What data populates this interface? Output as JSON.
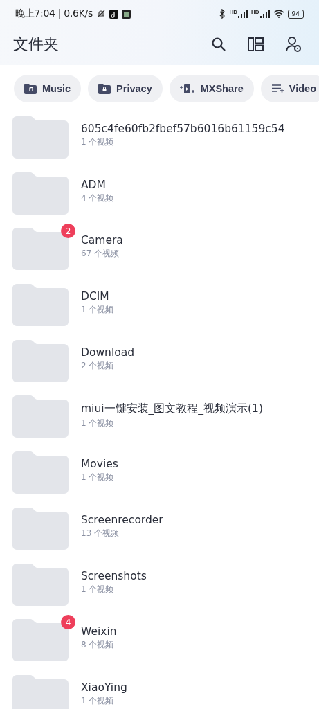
{
  "status_bar": {
    "time": "晚上7:04 | 0.6K/s",
    "signal_labels": [
      "HD",
      "HD"
    ],
    "battery": "94"
  },
  "header": {
    "title": "文件夹"
  },
  "chips": [
    {
      "label": "Music",
      "kind": "music"
    },
    {
      "label": "Privacy",
      "kind": "lock"
    },
    {
      "label": "MXShare",
      "kind": "share"
    },
    {
      "label": "Video",
      "kind": "playlist"
    }
  ],
  "folders": [
    {
      "name": "605c4fe60fb2fbef57b6016b61159c54",
      "count": "1 个视频"
    },
    {
      "name": "ADM",
      "count": "4 个视频"
    },
    {
      "name": "Camera",
      "count": "67 个视频",
      "badge": "2"
    },
    {
      "name": "DCIM",
      "count": "1 个视频"
    },
    {
      "name": "Download",
      "count": "2 个视频"
    },
    {
      "name": "miui一键安装_图文教程_视频演示(1)",
      "count": "1 个视频"
    },
    {
      "name": "Movies",
      "count": "1 个视频"
    },
    {
      "name": "Screenrecorder",
      "count": "13 个视频"
    },
    {
      "name": "Screenshots",
      "count": "1 个视频"
    },
    {
      "name": "Weixin",
      "count": "8 个视频",
      "badge": "4"
    },
    {
      "name": "XiaoYing",
      "count": "1 个视频"
    }
  ]
}
